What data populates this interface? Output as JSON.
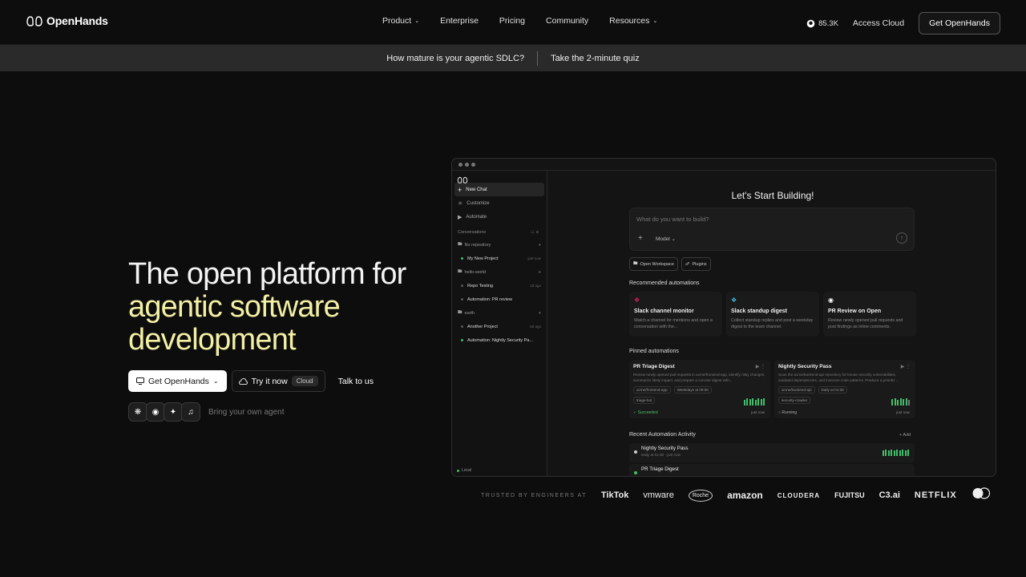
{
  "nav": {
    "logo": "OpenHands",
    "links": [
      {
        "label": "Product",
        "dropdown": true
      },
      {
        "label": "Enterprise",
        "dropdown": false
      },
      {
        "label": "Pricing",
        "dropdown": false
      },
      {
        "label": "Community",
        "dropdown": false
      },
      {
        "label": "Resources",
        "dropdown": true
      }
    ],
    "github_stars": "85.3K",
    "access_cloud": "Access Cloud",
    "get_button": "Get OpenHands"
  },
  "banner": {
    "question": "How mature is your agentic SDLC?",
    "cta": "Take the 2-minute quiz"
  },
  "hero": {
    "line1": "The open platform for",
    "line2": "agentic software",
    "line3": "development",
    "get_button": "Get OpenHands",
    "try_button": "Try it now",
    "try_badge": "Cloud",
    "talk": "Talk to us",
    "agents_label": "Bring your own agent"
  },
  "app": {
    "sidebar": {
      "new_chat": "New Chat",
      "customize": "Customize",
      "automate": "Automate",
      "conversations": "Conversations",
      "groups": [
        {
          "name": "No repository",
          "items": [
            {
              "title": "My New Project",
              "time": "just now",
              "status": "green"
            }
          ]
        },
        {
          "name": "hello-world",
          "items": [
            {
              "title": "Repo Testing",
              "time": "2d ago",
              "status": "grey"
            },
            {
              "title": "Automation: PR review",
              "time": "",
              "status": "grey"
            }
          ]
        },
        {
          "name": "earth",
          "items": [
            {
              "title": "Another Project",
              "time": "5d ago",
              "status": "grey"
            },
            {
              "title": "Automation: Nightly Security Pa...",
              "time": "",
              "status": "green"
            }
          ]
        }
      ],
      "local": "Local"
    },
    "main": {
      "heading": "Let's Start Building!",
      "prompt_placeholder": "What do you want to build?",
      "model_label": "Model",
      "chips": [
        "Open Workspace",
        "Plugins"
      ],
      "recommended_title": "Recommended automations",
      "recommended": [
        {
          "title": "Slack channel monitor",
          "desc": "Watch a channel for mentions and open a conversation with the...",
          "icon": "slack-icon"
        },
        {
          "title": "Slack standup digest",
          "desc": "Collect standup replies and post a weekday digest to the team channel.",
          "icon": "slack-icon"
        },
        {
          "title": "PR Review on Open",
          "desc": "Review newly opened pull requests and post findings as inline comments.",
          "icon": "github-icon"
        }
      ],
      "pinned_title": "Pinned automations",
      "pinned": [
        {
          "title": "PR Triage Digest",
          "desc": "Review newly opened pull requests in acme/frontend-app, identify risky changes, summarize likely impact, and prepare a concise digest with...",
          "tags": [
            "acme/frontend-app",
            "Weekdays at 09:00",
            "triage-bot"
          ],
          "status": "Succeeded",
          "time": "just now"
        },
        {
          "title": "Nightly Security Pass",
          "desc": "Scan the acme/backend-api repository for known security vulnerabilities, outdated dependencies, and insecure code patterns. Produce a prioritiz...",
          "tags": [
            "acme/backend-api",
            "Daily at 01:30",
            "security-crawler"
          ],
          "status": "Running",
          "time": "just now"
        }
      ],
      "activity_title": "Recent Automation Activity",
      "activity_add": "+ Add",
      "activity": [
        {
          "title": "Nightly Security Pass",
          "sub": "Daily at 01:30 · just now"
        },
        {
          "title": "PR Triage Digest",
          "sub": ""
        }
      ]
    }
  },
  "trusted": {
    "label": "TRUSTED BY ENGINEERS AT",
    "brands": [
      "TikTok",
      "vmware",
      "Roche",
      "amazon",
      "CLOUDERA",
      "FUJITSU",
      "C3.ai",
      "NETFLIX"
    ]
  }
}
